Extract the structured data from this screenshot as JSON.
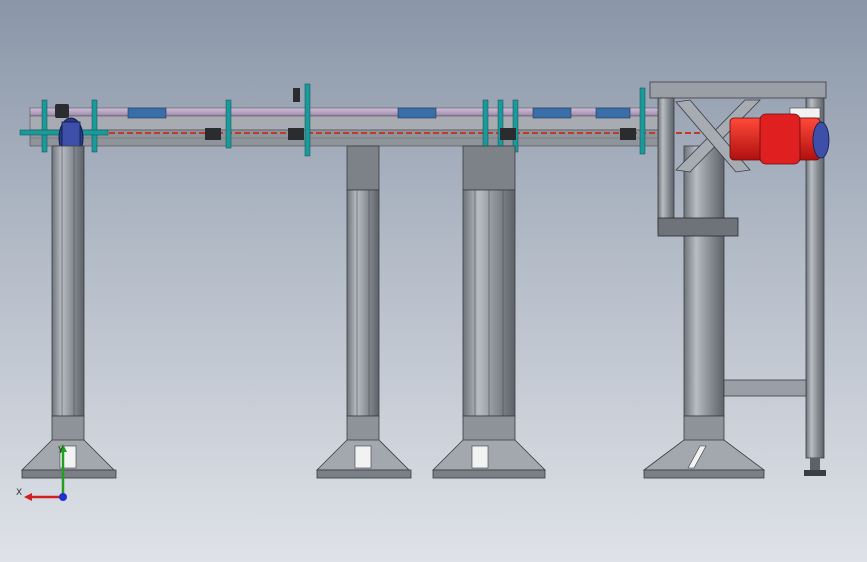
{
  "viewport": {
    "background_top": "#8a96a8",
    "background_bottom": "#dfe2e8"
  },
  "model": {
    "subject": "conveyor-assembly",
    "frame_color": "#9a9ea6",
    "rail_color": "#b9a0c8",
    "chain_color": "#c0392b",
    "motor_color": "#e02020",
    "bracket_color": "#1a9a9a",
    "plate_color": "#3a6ea8"
  },
  "triad": {
    "x_label": "X",
    "y_label": "Y",
    "x_color": "#d02020",
    "y_color": "#20a020",
    "z_color": "#2030d0"
  }
}
